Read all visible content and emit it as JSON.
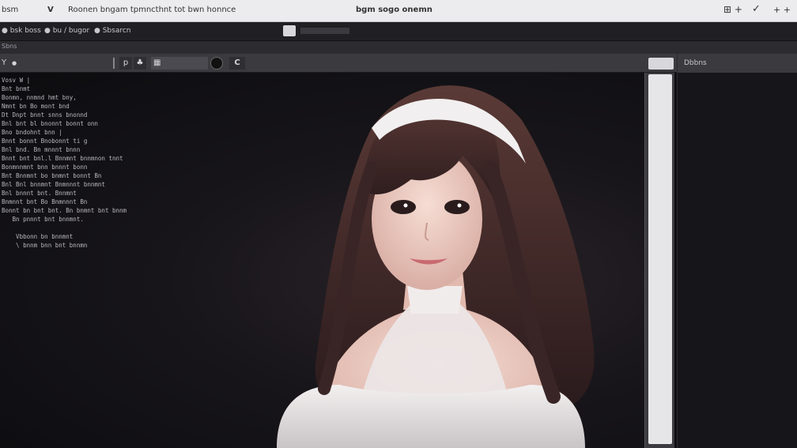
{
  "titlebar": {
    "app_label": "bsm",
    "menu_v": "V",
    "document_title": "Roonen bngam tpmncthnt tot bwn honnce",
    "center_title": "bgm sogo onemn",
    "right_actions": [
      "⊞ +",
      "✓",
      "+ +"
    ]
  },
  "menubar": {
    "items": [
      "bsk boss",
      "bu / bugor",
      "Sbsarcn"
    ]
  },
  "statusstrip": {
    "text": "Sbns"
  },
  "toolbar": {
    "left_items": [
      "Y",
      "●"
    ],
    "buttons": [
      "p",
      "♣",
      "▦"
    ],
    "cycle_label": "C"
  },
  "rightpanel": {
    "header": "Dbbns"
  },
  "log_lines": [
    "Vosv W |",
    "Bnt bnmt",
    "Bonmn, nnmnd hmt bny,",
    "Nmnt bn Bo mont bnd",
    "Dt Dnpt bnnt snns bnonnd",
    "Bnl bnt bl bnonnt bonnt onn",
    "Bno bndohnt bnn |",
    "Bnnt bonnt Bnobonnt ti g",
    "Bnl bnd. Bn mnnnt bnnn",
    "Bnnt bnt bnl.l Bnnmnt bnnmnon tnnt",
    "Bonmnnmnt bnn bnnnt bonn",
    "Bnt Bnnmnt bo bnmnt bonnt Bn",
    "Bnl Bnl bnnmnt Bnmnnnt bnnmnt",
    "Bnl bnnnt bnt. Bnnmnt",
    "Bnmnnt bnt Bo Bnmnnnt Bn",
    "Bonnt bn bnt bnt. Bn bnmnt bnt bnnm",
    "   Bn pnnnt bnt bnnmnt.",
    "",
    "    Vbbonn bn bnnmnt",
    "    \\ bnnm bnn bnt bnnmn"
  ],
  "colors": {
    "titlebar": "#ececee",
    "menubar": "#202024",
    "toolbar": "#3a3a3f",
    "canvas": "#0f0f12",
    "scroll_thumb": "#e6e6e8"
  }
}
